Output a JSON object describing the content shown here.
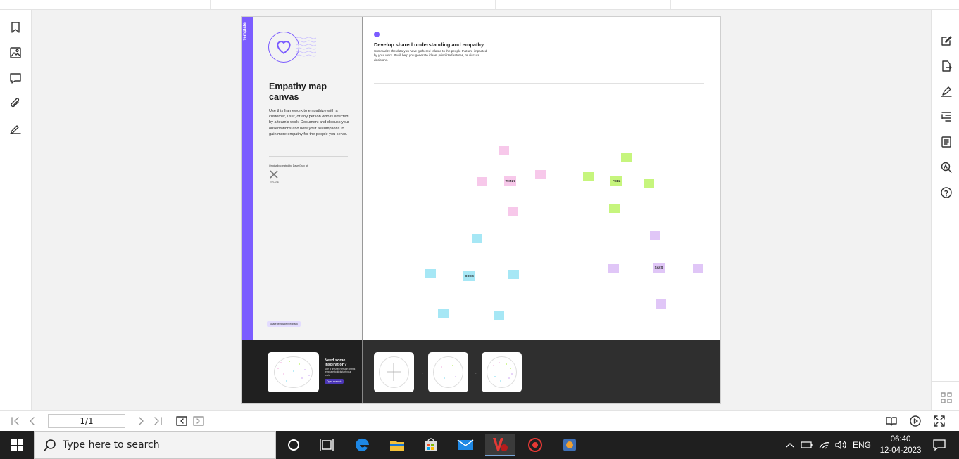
{
  "document": {
    "template_tag": "Template",
    "title": "Empathy map canvas",
    "description": "Use this framework to empathize with a customer, user, or any person who is affected by a team's work. Document and discuss your observations and note your assumptions to gain more empathy for the people you serve.",
    "credit": "Originally created by Dave Gray at",
    "credit_logo_label": "XPLANE",
    "feedback_label": "Share template feedback",
    "section_title": "Develop shared understanding and empathy",
    "section_desc": "Summarize the data you have gathered related to the people that are impacted by your work. It will help you generate ideas, prioritize features, or discuss decisions.",
    "categories": {
      "think": "THINK",
      "feel": "FEEL",
      "says": "SAYS",
      "does": "DOES"
    },
    "inspiration_title": "Need some inspiration?",
    "inspiration_desc": "See a finished version of this template to kickstart your work.",
    "inspiration_button": "Open example"
  },
  "nav": {
    "page_indicator": "1/1"
  },
  "taskbar": {
    "search_placeholder": "Type here to search",
    "language": "ENG",
    "time": "06:40",
    "date": "12-04-2023"
  },
  "colors": {
    "accent": "#7b5cff",
    "think": "#f7c8ea",
    "feel": "#c6f57d",
    "says": "#e0c6f7",
    "does": "#a6e7f5"
  }
}
